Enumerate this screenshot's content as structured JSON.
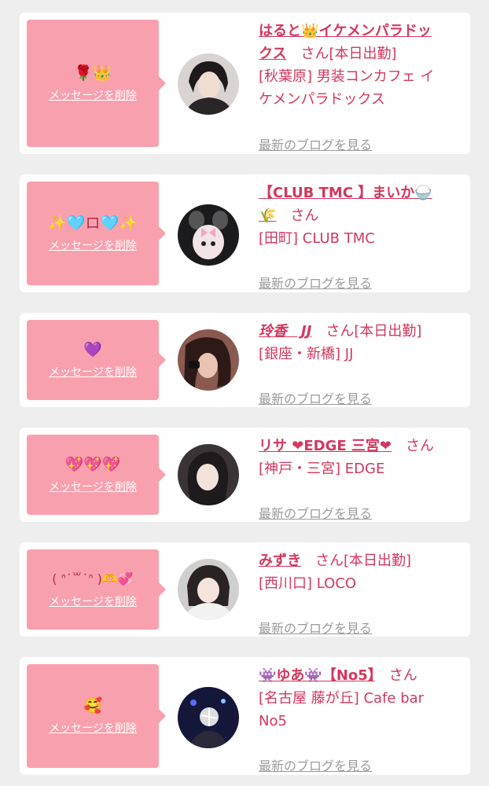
{
  "common": {
    "delete_label": "メッセージを削除",
    "blog_label": "最新のブログを見る",
    "san": "さん"
  },
  "messages": [
    {
      "message": "🌹👑",
      "name_l1": "はると👑イケメンパラドッ",
      "name_l2": "クス",
      "suffix": "[本日出勤]",
      "shop_l1": "[秋葉原] 男装コンカフェ イ",
      "shop_l2": "ケメンパラドックス"
    },
    {
      "message": "✨🩵ロ🩵✨",
      "name_l1": "【CLUB TMC 】まいか🍚",
      "name_l2": "🌾",
      "suffix": "",
      "shop_l1": "[田町] CLUB TMC",
      "shop_l2": ""
    },
    {
      "message": "💜",
      "name_l1": "玲香　JJ",
      "name_l2": "",
      "suffix": "[本日出勤]",
      "shop_l1": "[銀座・新橋] JJ",
      "shop_l2": ""
    },
    {
      "message": "💖💖💖",
      "name_l1": "リサ ❤EDGE 三宮❤",
      "name_l2": "",
      "suffix": "",
      "shop_l1": "[神戸・三宮] EDGE",
      "shop_l2": ""
    },
    {
      "message": "( ᐢ˙꒳˙ᐢ )🫶💞",
      "name_l1": "みずき",
      "name_l2": "",
      "suffix": "[本日出勤]",
      "shop_l1": "[西川口] LOCO",
      "shop_l2": ""
    },
    {
      "message": "🥰",
      "name_l1": "👾ゆあ👾【No5】",
      "name_l2": "",
      "suffix": "",
      "shop_l1": "[名古屋 藤が丘] Cafe bar",
      "shop_l2": "No5"
    }
  ]
}
